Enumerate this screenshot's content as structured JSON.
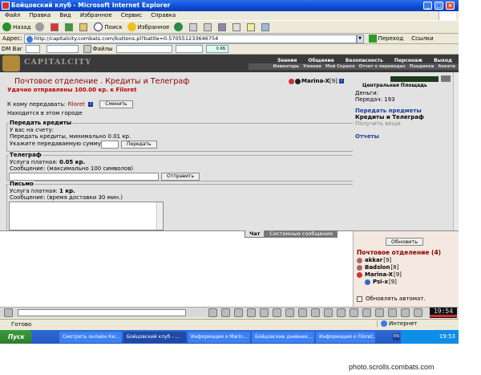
{
  "window": {
    "title": "Бойцовский клуб - Microsoft Internet Explorer",
    "minimize": "_",
    "maximize": "□",
    "close": "×"
  },
  "menu": [
    "Файл",
    "Правка",
    "Вид",
    "Избранное",
    "Сервис",
    "Справка"
  ],
  "toolbar": {
    "back": "Назад",
    "search": "Поиск",
    "favorites": "Избранное"
  },
  "address": {
    "label": "Адрес:",
    "url": "http://capitalcity.combats.com/buttons.pl?battle=0.570551233646754",
    "go": "Переход",
    "links": "Ссылки"
  },
  "linksbar": {
    "dm": "DM Bar",
    "files": "Файлы",
    "kb": "0 КБ"
  },
  "game": {
    "city": "CAPITALCITY",
    "menu": [
      "Знания",
      "Общение",
      "Безопасность",
      "Персонаж",
      "Выход"
    ],
    "submenu": [
      "Инвентарь",
      "Умения",
      "Мой Скрапл",
      "Отчет о переводах",
      "Поединки",
      "Анкета"
    ]
  },
  "post": {
    "title": "Почтовое отделение .  Кредиты и Телеграф",
    "notice": "Удачно отправлены 100.00 кр. к Filoret",
    "user": "Marina-X",
    "user_level": "[9]",
    "recipient_label": "К кому передавать:",
    "recipient": "Filoret",
    "change_button": "Сменить",
    "in_city": "Находится в этом городе"
  },
  "credits": {
    "caption": "Передать кредиты",
    "on_account": "У вас на счету:",
    "min": "Передать кредиты, минимально 0.01 кр.",
    "sum_label": "Укажите передаваемую сумму:",
    "send_button": "Передать"
  },
  "telegraph": {
    "caption": "Телеграф",
    "paid_label": "Услуга платная:",
    "paid_value": "0.05 кр.",
    "message": "Сообщение: (максимально 100 символов)",
    "send_button": "Отправить"
  },
  "letter": {
    "caption": "Письмо",
    "paid_label": "Услуга платная:",
    "paid_value": "1 кр.",
    "message": "Сообщение: (время доставки 30 мин.)"
  },
  "side": {
    "location": "Центральная Площадь",
    "money": "Деньги:",
    "transfers": "Передач: 193",
    "links": [
      "Передать предметы",
      "Кредиты и Телеграф",
      "Получить вещи",
      "Отчеты"
    ]
  },
  "chat": {
    "tab_chat": "Чат",
    "tab_system": "Системные сообщения"
  },
  "online": {
    "refresh": "Обновить",
    "title": "Почтовое отделение (4)",
    "players": [
      {
        "name": "akkar",
        "level": "[9]"
      },
      {
        "name": "Badslon",
        "level": "[8]"
      },
      {
        "name": "Marina-X",
        "level": "[9]"
      },
      {
        "name": "Psi-x",
        "level": "[9]"
      }
    ],
    "auto_refresh": "Обновлять автомат."
  },
  "clock": "19:54",
  "status": {
    "done": "Готово",
    "zone": "Интернет"
  },
  "taskbar": {
    "start": "Пуск",
    "tasks": [
      "Смотреть онлайн Ки...",
      "Бойцовский клуб - ...",
      "Информация о Marin...",
      "Бойцовские дневник...",
      "Информация о Filoret..."
    ],
    "lang": "EN",
    "time": "19:53"
  },
  "credit": "photo.scrolls.combats.com"
}
